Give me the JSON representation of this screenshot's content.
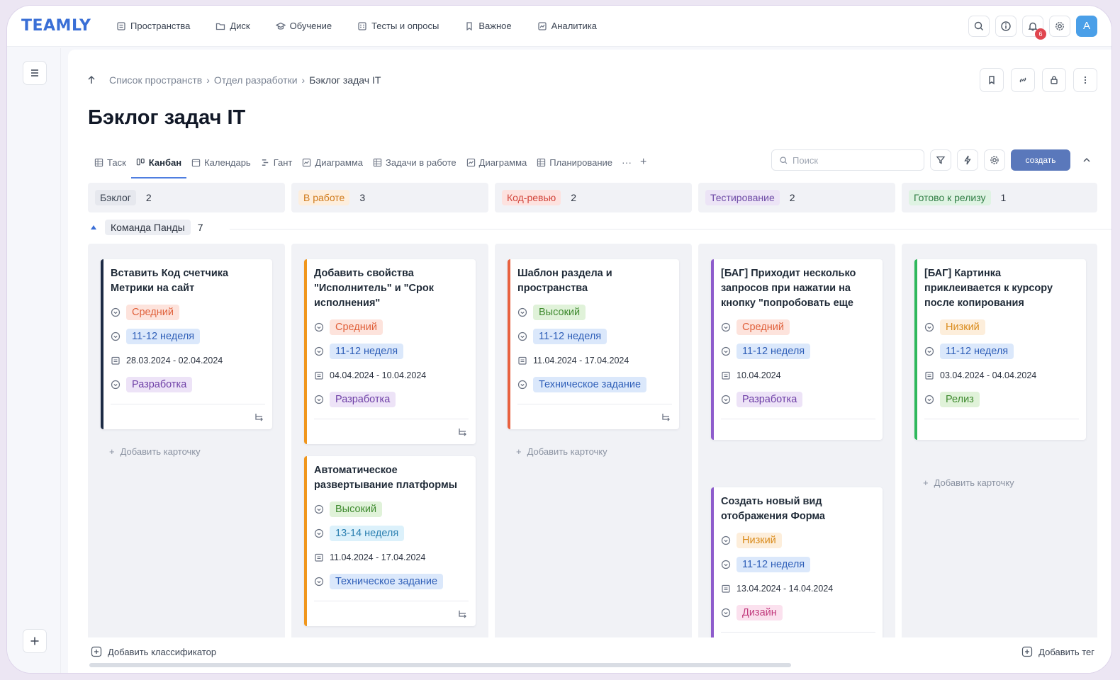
{
  "app": {
    "logo": "TEAMLY"
  },
  "nav": [
    {
      "label": "Пространства",
      "icon": "spaces-icon"
    },
    {
      "label": "Диск",
      "icon": "folder-icon"
    },
    {
      "label": "Обучение",
      "icon": "learning-icon"
    },
    {
      "label": "Тесты и опросы",
      "icon": "tests-icon"
    },
    {
      "label": "Важное",
      "icon": "bookmark-icon"
    },
    {
      "label": "Аналитика",
      "icon": "analytics-icon"
    }
  ],
  "top_actions": {
    "notifications_count": "6",
    "avatar_letter": "A"
  },
  "breadcrumb": [
    "Список пространств",
    "Отдел разработки",
    "Бэклог задач IT"
  ],
  "page": {
    "title": "Бэклог задач IT"
  },
  "tabs": [
    {
      "label": "Таск",
      "active": false
    },
    {
      "label": "Канбан",
      "active": true
    },
    {
      "label": "Календарь",
      "active": false
    },
    {
      "label": "Гант",
      "active": false
    },
    {
      "label": "Диаграмма",
      "active": false
    },
    {
      "label": "Задачи в работе",
      "active": false
    },
    {
      "label": "Диаграмма",
      "active": false
    },
    {
      "label": "Планирование",
      "active": false
    }
  ],
  "tabs_more": "···",
  "tabs_add": "+",
  "toolbar": {
    "search_placeholder": "Поиск",
    "create_label": "создать"
  },
  "group": {
    "name": "Команда Панды",
    "count": "7"
  },
  "columns": [
    {
      "status": "Бэклог",
      "count": "2",
      "color": "#e6e8ee",
      "text": "#3b4453"
    },
    {
      "status": "В работе",
      "count": "3",
      "color": "#fdeedd",
      "text": "#d07a1a"
    },
    {
      "status": "Код-ревью",
      "count": "2",
      "color": "#fde2df",
      "text": "#d2453b"
    },
    {
      "status": "Тестирование",
      "count": "2",
      "color": "#ece4f6",
      "text": "#6e4ba6"
    },
    {
      "status": "Готово к релизу",
      "count": "1",
      "color": "#dff3e3",
      "text": "#2f7d44"
    }
  ],
  "cards": [
    {
      "title": "Вставить Код счетчика Метрики на сайт",
      "priority": "Средний",
      "sprint": "11-12 неделя",
      "dates": "28.03.2024 - 02.04.2024",
      "type": "Разработка"
    },
    {
      "title": "Добавить свойства \"Исполнитель\" и \"Срок исполнения\"",
      "priority": "Средний",
      "sprint": "11-12 неделя",
      "dates": "04.04.2024 - 10.04.2024",
      "type": "Разработка"
    },
    {
      "title": "Автоматическое развертывание платформы",
      "priority": "Высокий",
      "sprint": "13-14 неделя",
      "dates": "11.04.2024 - 17.04.2024",
      "type": "Техническое задание"
    },
    {
      "title": "Шаблон раздела и пространства",
      "priority": "Высокий",
      "sprint": "11-12 неделя",
      "dates": "11.04.2024 - 17.04.2024",
      "type": "Техническое задание"
    },
    {
      "title": "[БАГ] Приходит несколько запросов при нажатии на кнопку \"попробовать еще",
      "priority": "Средний",
      "sprint": "11-12 неделя",
      "dates": "10.04.2024",
      "type": "Разработка"
    },
    {
      "title": "Создать новый вид отображения Форма",
      "priority": "Низкий",
      "sprint": "11-12 неделя",
      "dates": "13.04.2024 - 14.04.2024",
      "type": "Дизайн"
    },
    {
      "title": "[БАГ] Картинка приклеивается к курсору после копирования",
      "priority": "Низкий",
      "sprint": "11-12 неделя",
      "dates": "03.04.2024 - 04.04.2024",
      "type": "Релиз"
    }
  ],
  "add_card_label": "Добавить карточку",
  "bottom": {
    "add_classifier": "Добавить классификатор",
    "add_tag": "Добавить тег"
  }
}
